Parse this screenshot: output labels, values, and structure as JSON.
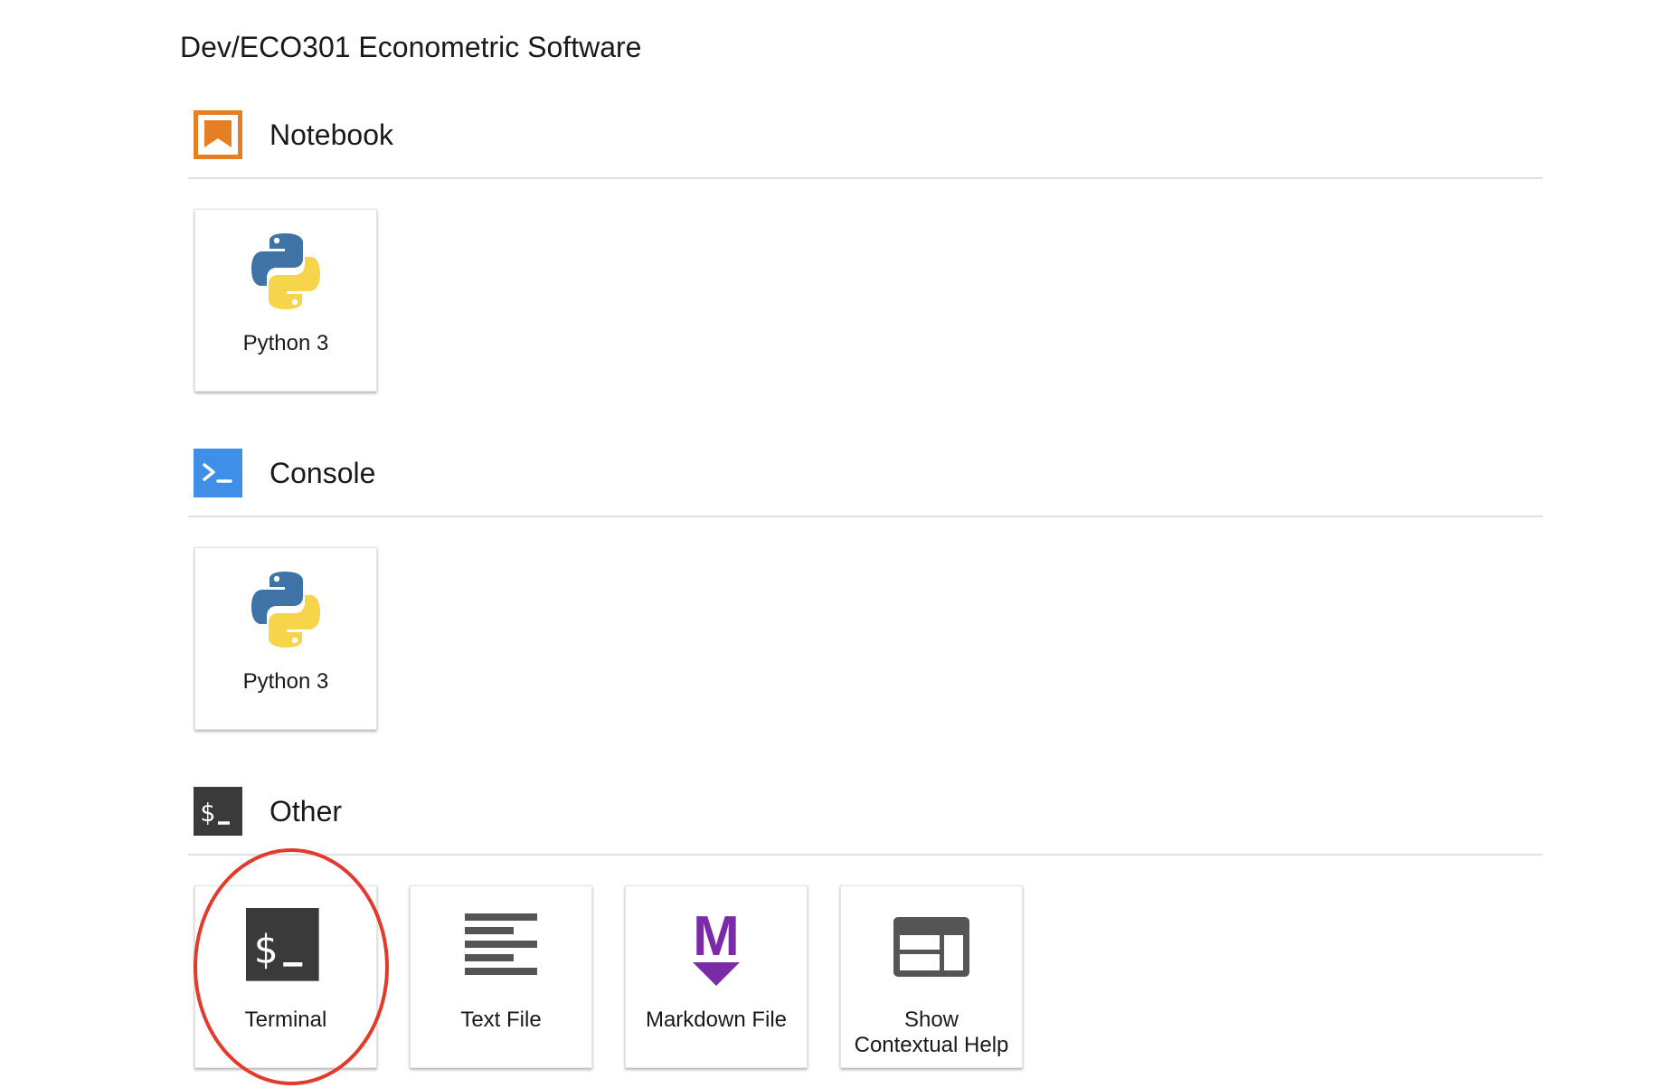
{
  "launcher": {
    "path": "Dev/ECO301 Econometric Software"
  },
  "sections": {
    "notebook": {
      "title": "Notebook",
      "icon": "notebook-bookmark-icon",
      "items": [
        {
          "label": "Python 3",
          "icon": "python-logo-icon"
        }
      ]
    },
    "console": {
      "title": "Console",
      "icon": "console-prompt-icon",
      "items": [
        {
          "label": "Python 3",
          "icon": "python-logo-icon"
        }
      ]
    },
    "other": {
      "title": "Other",
      "icon": "terminal-dollar-icon",
      "items": [
        {
          "label": "Terminal",
          "icon": "terminal-icon"
        },
        {
          "label": "Text File",
          "icon": "text-lines-icon"
        },
        {
          "label": "Markdown File",
          "icon": "markdown-icon"
        },
        {
          "label": "Show\nContextual Help",
          "label_line1": "Show",
          "label_line2": "Contextual Help",
          "icon": "contextual-help-icon"
        }
      ]
    }
  },
  "annotation": {
    "highlight_color": "#e23b2e",
    "highlighted_item": "Terminal"
  },
  "colors": {
    "notebook_orange": "#e67e22",
    "console_blue": "#3f8ee8",
    "terminal_dark": "#3a3a3a",
    "markdown_purple": "#7b2aa8",
    "help_gray": "#555555",
    "python_blue": "#3f72a5",
    "python_yellow": "#f7d54a"
  }
}
